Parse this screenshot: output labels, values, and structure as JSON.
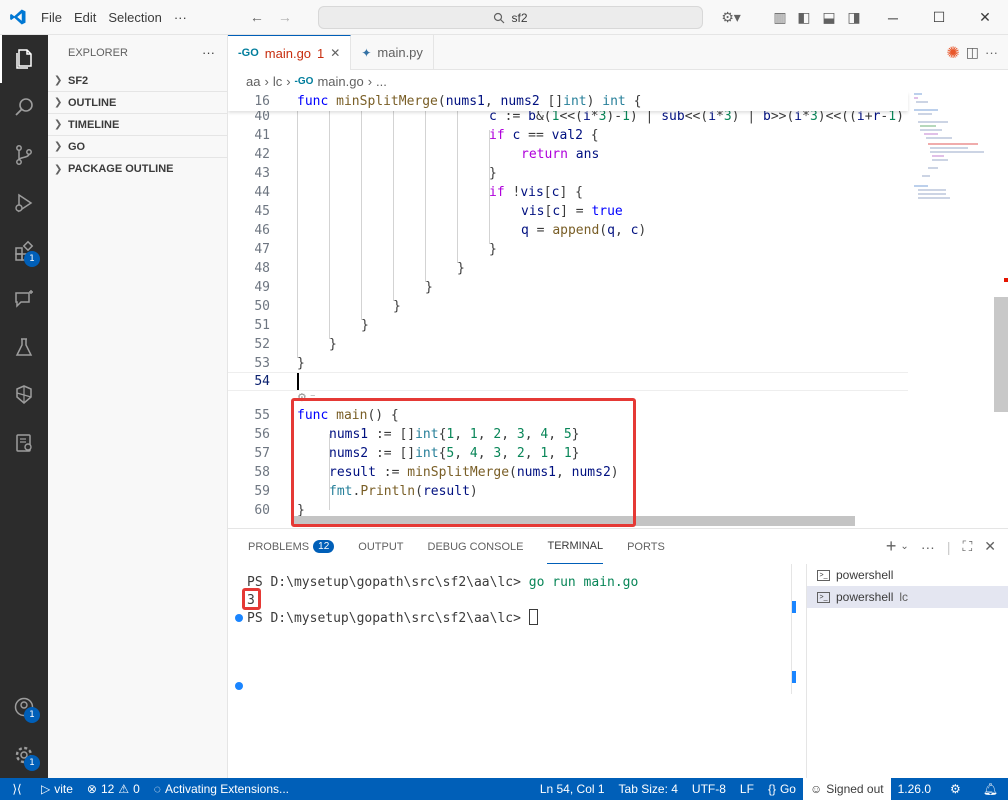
{
  "titlebar": {
    "menu": [
      "File",
      "Edit",
      "Selection"
    ],
    "more": "···",
    "search": "sf2"
  },
  "sidebar": {
    "title": "EXPLORER",
    "more": "···",
    "sections": [
      "SF2",
      "OUTLINE",
      "TIMELINE",
      "GO",
      "PACKAGE OUTLINE"
    ]
  },
  "activity_badges": {
    "extensions": "1",
    "accounts": "1",
    "settings": "1"
  },
  "tabs": [
    {
      "label": "main.go",
      "modified_count": "1",
      "active": true
    },
    {
      "label": "main.py",
      "active": false
    }
  ],
  "breadcrumb": [
    "aa",
    "lc",
    "main.go",
    "..."
  ],
  "editor": {
    "sticky": {
      "num": "16",
      "text": "func minSplitMerge(nums1, nums2 []int) int {"
    },
    "lines": [
      {
        "num": "40",
        "text": "c := b&(1<<(i*3)-1) | sub<<(i*3) | b>>(i*3)<<((i+r-1)"
      },
      {
        "num": "41",
        "text": "if c == val2 {"
      },
      {
        "num": "42",
        "text": "return ans"
      },
      {
        "num": "43",
        "text": "}"
      },
      {
        "num": "44",
        "text": "if !vis[c] {"
      },
      {
        "num": "45",
        "text": "vis[c] = true"
      },
      {
        "num": "46",
        "text": "q = append(q, c)"
      },
      {
        "num": "47",
        "text": "}"
      },
      {
        "num": "48",
        "text": "}"
      },
      {
        "num": "49",
        "text": "}"
      },
      {
        "num": "50",
        "text": "}"
      },
      {
        "num": "51",
        "text": "}"
      },
      {
        "num": "52",
        "text": "}"
      },
      {
        "num": "53",
        "text": "}"
      },
      {
        "num": "54",
        "text": ""
      },
      {
        "num": "55",
        "text": "func main() {"
      },
      {
        "num": "56",
        "text": "nums1 := []int{1, 1, 2, 3, 4, 5}"
      },
      {
        "num": "57",
        "text": "nums2 := []int{5, 4, 3, 2, 1, 1}"
      },
      {
        "num": "58",
        "text": "result := minSplitMerge(nums1, nums2)"
      },
      {
        "num": "59",
        "text": "fmt.Println(result)"
      },
      {
        "num": "60",
        "text": "}"
      }
    ]
  },
  "panel": {
    "tabs": [
      "PROBLEMS",
      "OUTPUT",
      "DEBUG CONSOLE",
      "TERMINAL",
      "PORTS"
    ],
    "problems_count": "12",
    "terminal": {
      "line1_prompt": "PS D:\\mysetup\\gopath\\src\\sf2\\aa\\lc> ",
      "line1_cmd": "go run main.go",
      "output": "3",
      "line2_prompt": "PS D:\\mysetup\\gopath\\src\\sf2\\aa\\lc> "
    },
    "terminal_list": [
      {
        "name": "powershell",
        "sub": ""
      },
      {
        "name": "powershell",
        "sub": "lc"
      }
    ]
  },
  "statusbar": {
    "vite": "vite",
    "errors": "12",
    "warnings": "0",
    "activity": "Activating Extensions...",
    "position": "Ln 54, Col 1",
    "tabsize": "Tab Size: 4",
    "encoding": "UTF-8",
    "eol": "LF",
    "language": "Go",
    "account": "Signed out",
    "go_version": "1.26.0"
  }
}
